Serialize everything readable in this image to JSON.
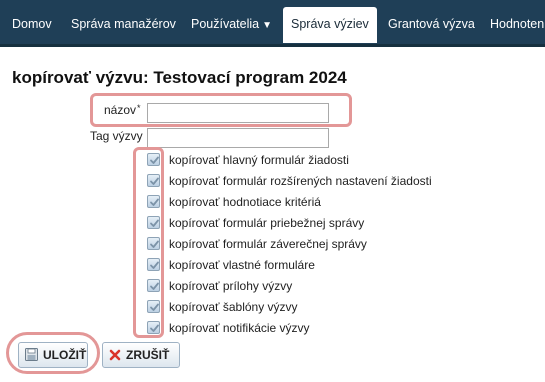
{
  "nav": {
    "items": [
      {
        "label": "Domov"
      },
      {
        "label": "Správa manažérov"
      },
      {
        "label": "Používatelia",
        "caret": "▼"
      },
      {
        "label": "Správa výziev",
        "active": true
      },
      {
        "label": "Grantová výzva"
      },
      {
        "label": "Hodnotenie"
      }
    ]
  },
  "page": {
    "title": "kopírovať výzvu: Testovací program 2024"
  },
  "form": {
    "nazov_label": "názov",
    "required_mark": "*",
    "nazov_value": "",
    "tag_label": "Tag výzvy",
    "tag_value": "",
    "checkboxes": [
      {
        "label": "kopírovať hlavný formulár žiadosti",
        "checked": true
      },
      {
        "label": "kopírovať formulár rozšírených nastavení žiadosti",
        "checked": true
      },
      {
        "label": "kopírovať hodnotiace kritériá",
        "checked": true
      },
      {
        "label": "kopírovať formulár priebežnej správy",
        "checked": true
      },
      {
        "label": "kopírovať formulár záverečnej správy",
        "checked": true
      },
      {
        "label": "kopírovať vlastné formuláre",
        "checked": true
      },
      {
        "label": "kopírovať prílohy výzvy",
        "checked": true
      },
      {
        "label": "kopírovať šablóny výzvy",
        "checked": true
      },
      {
        "label": "kopírovať notifikácie výzvy",
        "checked": true
      }
    ]
  },
  "buttons": {
    "save": "ULOŽIŤ",
    "cancel": "ZRUŠIŤ"
  },
  "colors": {
    "navbar": "#1f3f57",
    "highlight": "#e39797",
    "cancel_icon": "#d9342b"
  }
}
